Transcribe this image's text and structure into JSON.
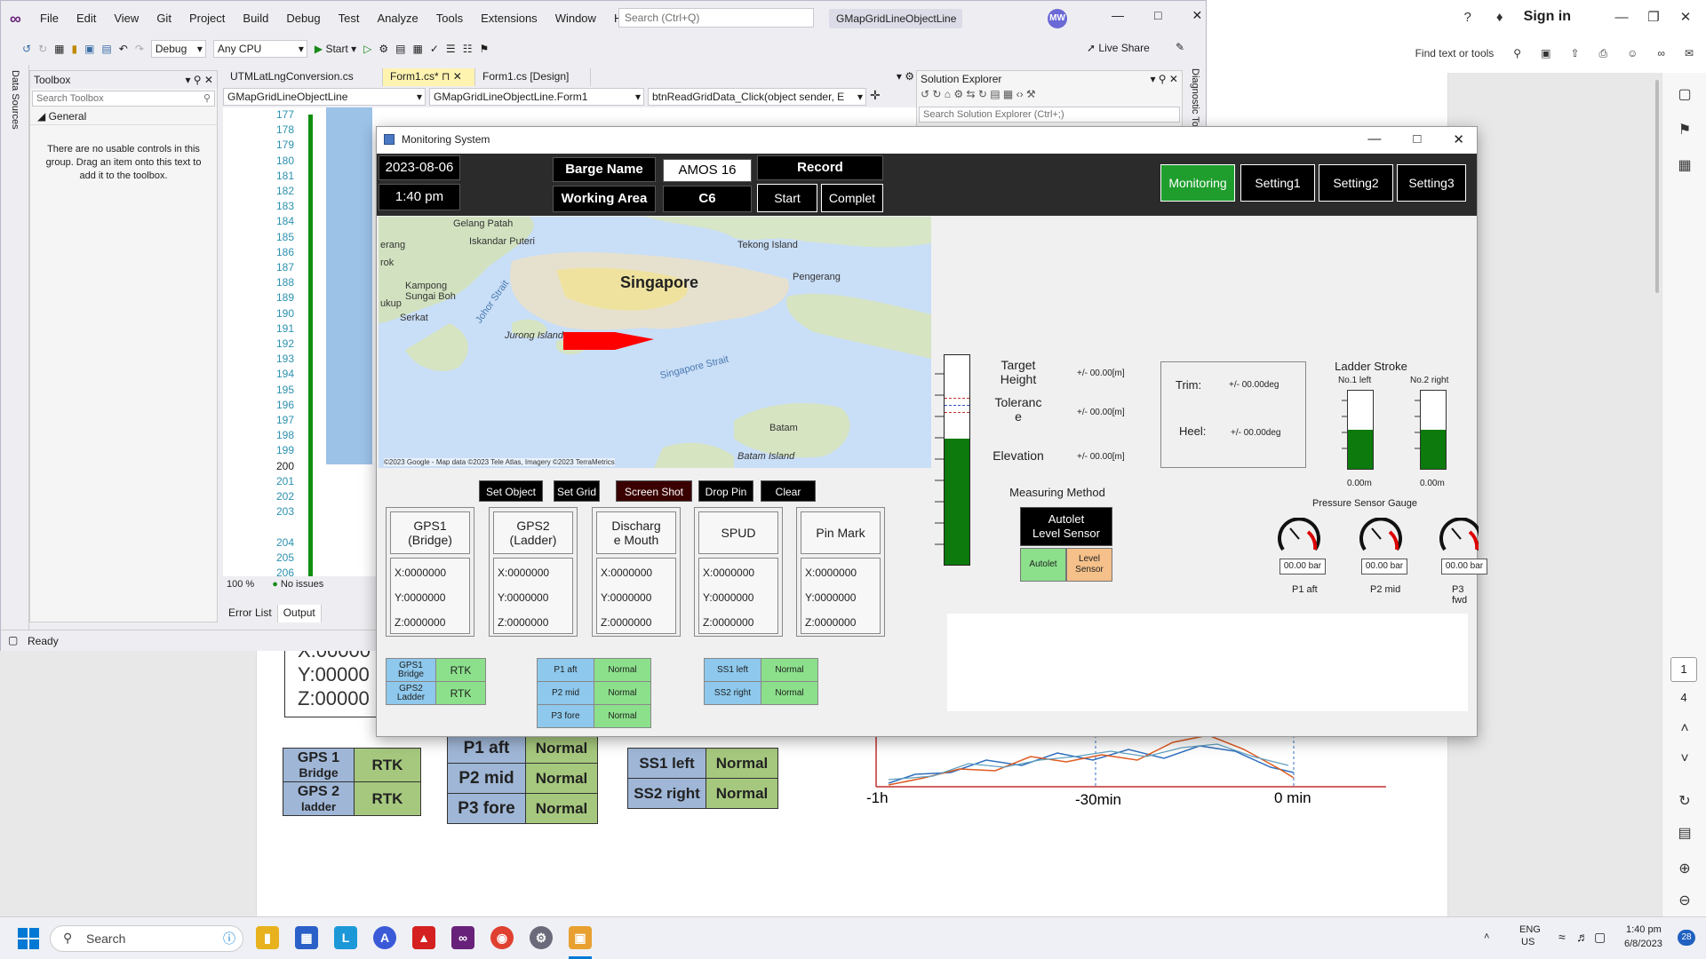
{
  "pdf": {
    "sign_in": "Sign in",
    "find_tools": "Find text or tools",
    "page_number": "1",
    "page_total": "4",
    "doc": {
      "xyz": [
        "X:00000",
        "Y:00000",
        "Z:00000"
      ],
      "gps_table": [
        {
          "name": "GPS 1",
          "sub": "Bridge",
          "value": "RTK"
        },
        {
          "name": "GPS 2",
          "sub": "ladder",
          "value": "RTK"
        }
      ],
      "p_table": [
        {
          "name": "P1 aft",
          "value": "Normal"
        },
        {
          "name": "P2 mid",
          "value": "Normal"
        },
        {
          "name": "P3 fore",
          "value": "Normal"
        }
      ],
      "ss_table": [
        {
          "name": "SS1 left",
          "value": "Normal"
        },
        {
          "name": "SS2 right",
          "value": "Normal"
        }
      ],
      "chart_axis": [
        "-1h",
        "-30min",
        "0 min"
      ]
    }
  },
  "chart_data": {
    "type": "line",
    "title": "",
    "xlabel": "",
    "ylabel": "",
    "categories": [
      "-1h",
      "-30min",
      "0 min"
    ],
    "series": [],
    "note_colors": [
      "#e05a20",
      "#3070c0",
      "#60a0c0"
    ]
  },
  "vs": {
    "menu": [
      "File",
      "Edit",
      "View",
      "Git",
      "Project",
      "Build",
      "Debug",
      "Test",
      "Analyze",
      "Tools",
      "Extensions",
      "Window",
      "Help"
    ],
    "search_placeholder": "Search (Ctrl+Q)",
    "solution_name": "GMapGridLineObjectLine",
    "avatar": "MW",
    "config": "Debug",
    "platform": "Any CPU",
    "start": "Start",
    "live_share": "Live Share",
    "data_sources": "Data Sources",
    "toolbox": {
      "title": "Toolbox",
      "search": "Search Toolbox",
      "group": "General",
      "message": "There are no usable controls in this group. Drag an item onto this text to add it to the toolbox."
    },
    "tabs": [
      "UTMLatLngConversion.cs",
      "Form1.cs*",
      "Form1.cs [Design]"
    ],
    "nav": [
      "GMapGridLineObjectLine",
      "GMapGridLineObjectLine.Form1",
      "btnReadGridData_Click(object sender, E"
    ],
    "line_numbers": [
      "177",
      "178",
      "179",
      "180",
      "181",
      "182",
      "183",
      "184",
      "185",
      "186",
      "187",
      "188",
      "189",
      "190",
      "191",
      "192",
      "193",
      "194",
      "195",
      "196",
      "197",
      "198",
      "199",
      "200",
      "201",
      "202",
      "203",
      "",
      "204",
      "205",
      "206",
      "207"
    ],
    "zoom": "100 %",
    "issues": "No issues",
    "bottom_tabs": [
      "Error List",
      "Output"
    ],
    "solution_explorer": {
      "title": "Solution Explorer",
      "search": "Search Solution Explorer (Ctrl+;)"
    },
    "diagnostic": "Diagnostic To",
    "status": "Ready"
  },
  "ms": {
    "title": "Monitoring System",
    "date": "2023-08-06",
    "time": "1:40 pm",
    "barge_label": "Barge Name",
    "barge_value": "AMOS 16",
    "area_label": "Working Area",
    "area_value": "C6",
    "record_label": "Record",
    "start_btn": "Start",
    "complete_btn": "Complet",
    "nav_buttons": [
      "Monitoring",
      "Setting1",
      "Setting2",
      "Setting3"
    ],
    "map_labels": [
      {
        "text": "Gelang Patah",
        "size": "11"
      },
      {
        "text": "Iskandar Puteri",
        "size": "11"
      },
      {
        "text": "erang",
        "size": "11"
      },
      {
        "text": "rok",
        "size": "11"
      },
      {
        "text": "Kampong Sungai Boh",
        "size": "11"
      },
      {
        "text": "ukup",
        "size": "11"
      },
      {
        "text": "Serkat",
        "size": "11"
      },
      {
        "text": "Singapore",
        "size": "18"
      },
      {
        "text": "Tekong Island",
        "size": "11"
      },
      {
        "text": "Pengerang",
        "size": "11"
      },
      {
        "text": "Johor Strait",
        "size": "11"
      },
      {
        "text": "Jurong Island",
        "size": "11"
      },
      {
        "text": "Singapore Strait",
        "size": "11"
      },
      {
        "text": "Batam",
        "size": "11"
      },
      {
        "text": "Batam Island",
        "size": "11"
      }
    ],
    "map_copyright": "©2023 Google - Map data ©2023 Tele Atlas, Imagery ©2023 TerraMetrics",
    "map_buttons": [
      "Set Object",
      "Set Grid",
      "Screen Shot",
      "Drop Pin",
      "Clear"
    ],
    "gps_cards": [
      {
        "title": "GPS1\n(Bridge)",
        "x": "X:0000000",
        "y": "Y:0000000",
        "z": "Z:0000000"
      },
      {
        "title": "GPS2\n(Ladder)",
        "x": "X:0000000",
        "y": "Y:0000000",
        "z": "Z:0000000"
      },
      {
        "title": "Discharg\ne Mouth",
        "x": "X:0000000",
        "y": "Y:0000000",
        "z": "Z:0000000"
      },
      {
        "title": "SPUD",
        "x": "X:0000000",
        "y": "Y:0000000",
        "z": "Z:0000000"
      },
      {
        "title": "Pin Mark",
        "x": "X:0000000",
        "y": "Y:0000000",
        "z": "Z:0000000"
      }
    ],
    "status_gps": [
      {
        "name": "GPS1\nBridge",
        "value": "RTK"
      },
      {
        "name": "GPS2\nLadder",
        "value": "RTK"
      }
    ],
    "status_p": [
      {
        "name": "P1 aft",
        "value": "Normal"
      },
      {
        "name": "P2 mid",
        "value": "Normal"
      },
      {
        "name": "P3 fore",
        "value": "Normal"
      }
    ],
    "status_ss": [
      {
        "name": "SS1 left",
        "value": "Normal"
      },
      {
        "name": "SS2 right",
        "value": "Normal"
      }
    ],
    "level": {
      "target_label": "Target\nHeight",
      "target_value": "+/- 00.00[m]",
      "tolerance_label": "Toleranc\ne",
      "tolerance_value": "+/- 00.00[m]",
      "elevation_label": "Elevation",
      "elevation_value": "+/- 00.00[m]",
      "fill_fraction": 0.6
    },
    "measuring": {
      "title": "Measuring Method",
      "selected": "Autolet\nLevel Sensor",
      "opt1": "Autolet",
      "opt2": "Level\nSensor"
    },
    "trim_label": "Trim:",
    "trim_value": "+/- 00.00deg",
    "heel_label": "Heel:",
    "heel_value": "+/- 00.00deg",
    "ladder": {
      "title": "Ladder Stroke",
      "left_label": "No.1 left",
      "right_label": "No.2 right",
      "left_value": "0.00m",
      "right_value": "0.00m",
      "left_fill": 0.5,
      "right_fill": 0.5
    },
    "pressure": {
      "title": "Pressure Sensor Gauge",
      "gauges": [
        {
          "value": "00.00 bar",
          "label": "P1 aft"
        },
        {
          "value": "00.00 bar",
          "label": "P2 mid"
        },
        {
          "value": "00.00 bar",
          "label": "P3 fwd"
        }
      ]
    }
  },
  "taskbar": {
    "search": "Search",
    "lang1": "ENG",
    "lang2": "US",
    "time": "1:40 pm",
    "date": "6/8/2023",
    "badge": "28"
  }
}
